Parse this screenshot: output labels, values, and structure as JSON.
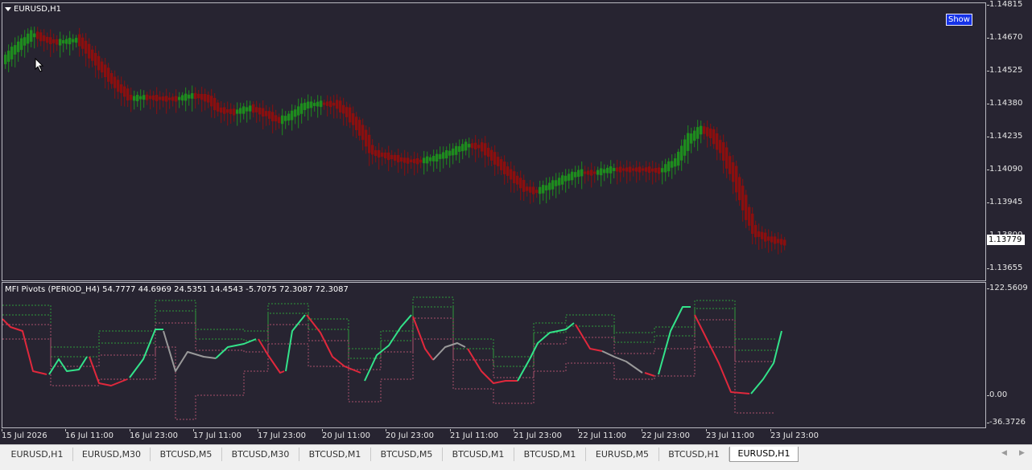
{
  "window": {
    "symbol_title": "EURUSD,H1",
    "show_button": "Show",
    "current_price": "1.13779",
    "indicator_title": "MFI Pivots (PERIOD_H4) 54.7777 44.6969 24.5351 14.4543 -5.7075 72.3087 72.3087",
    "colors": {
      "background": "#272431",
      "bull_candle": "#1e8c1e",
      "bear_candle": "#8b0f0f",
      "mfi_up": "#33e38a",
      "mfi_down": "#e0283c",
      "mfi_flat": "#9a9a9a",
      "pivot_green": "#2f9a3a",
      "pivot_pink": "#a8506a"
    }
  },
  "price_scale": [
    "1.14815",
    "1.14670",
    "1.14525",
    "1.14380",
    "1.14235",
    "1.14090",
    "1.13945",
    "1.13800",
    "1.13655"
  ],
  "indicator_scale": [
    "122.5609",
    "0.00",
    "-36.3726"
  ],
  "time_axis": [
    "15 Jul 2026",
    "16 Jul 11:00",
    "16 Jul 23:00",
    "17 Jul 11:00",
    "17 Jul 23:00",
    "20 Jul 11:00",
    "20 Jul 23:00",
    "21 Jul 11:00",
    "21 Jul 23:00",
    "22 Jul 11:00",
    "22 Jul 23:00",
    "23 Jul 11:00",
    "23 Jul 23:00"
  ],
  "tabs": [
    "EURUSD,H1",
    "EURUSD,M30",
    "BTCUSD,M5",
    "BTCUSD,M30",
    "BTCUSD,M1",
    "BTCUSD,M5",
    "BTCUSD,M1",
    "BTCUSD,M1",
    "EURUSD,M5",
    "BTCUSD,H1",
    "EURUSD,H1"
  ],
  "active_tab_index": 10
}
